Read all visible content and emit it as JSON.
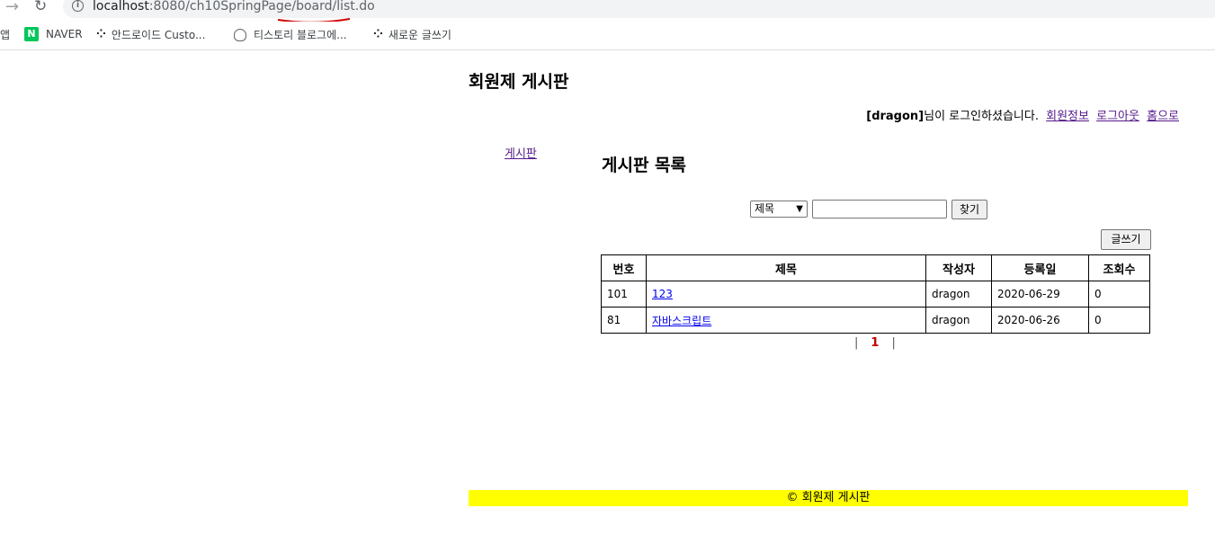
{
  "browser": {
    "url_host": "localhost",
    "url_rest": ":8080/ch10SpringPage/board/list.do",
    "bookmarks": {
      "apps": "앱",
      "naver": "NAVER",
      "android": "안드로이드 Custo...",
      "tistory": "티스토리 블로그에...",
      "new_post": "새로운 글쓰기"
    },
    "naver_icon_letter": "N"
  },
  "header": {
    "title": "회원제 게시판",
    "user_id": "[dragon]",
    "login_message": "님이 로그인하셨습니다.",
    "links": {
      "member_info": "회원정보",
      "logout": "로그아웃",
      "home": "홈으로"
    }
  },
  "sidebar": {
    "board_link": "게시판"
  },
  "main": {
    "section_title": "게시판 목록",
    "search": {
      "selected_option": "제목",
      "button": "찾기"
    },
    "write_button": "글쓰기",
    "table": {
      "headers": {
        "no": "번호",
        "title": "제목",
        "writer": "작성자",
        "date": "등록일",
        "hits": "조회수"
      },
      "rows": [
        {
          "no": "101",
          "title": "123",
          "writer": "dragon",
          "date": "2020-06-29",
          "hits": "0"
        },
        {
          "no": "81",
          "title": "자바스크립트",
          "writer": "dragon",
          "date": "2020-06-26",
          "hits": "0"
        }
      ]
    },
    "pagination": {
      "separator": "|",
      "current_page": "1"
    }
  },
  "footer": {
    "text": "© 회원제 게시판"
  },
  "colors": {
    "footer_bg": "#ffff00",
    "current_page": "#c00000",
    "visited_link": "#551a8b",
    "link": "#0000ee"
  }
}
